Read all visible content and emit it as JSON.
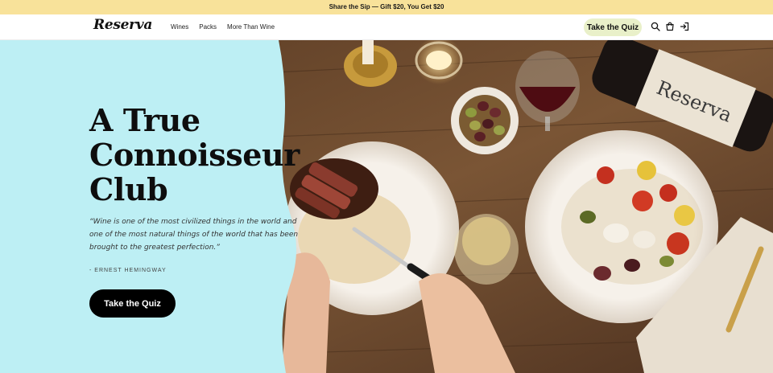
{
  "announcement": {
    "text": "Share the Sip — Gift $20, You Get $20"
  },
  "nav": {
    "logo": "Reserva",
    "links": [
      "Wines",
      "Packs",
      "More Than Wine"
    ],
    "quiz_button": "Take the Quiz",
    "icons": [
      "search-icon",
      "cart-icon",
      "sign-in-icon"
    ]
  },
  "hero": {
    "headline": "A True Connoisseur Club",
    "quote": "“Wine is one of the most civilized things in the world and one of the most natural things of the world that has been brought to the greatest perfection.”",
    "attribution": "- ERNEST HEMINGWAY",
    "cta": "Take the Quiz",
    "bottle_label": "Reserva",
    "panel_color": "#bdeff4"
  },
  "colors": {
    "announcement_bg": "#f8e29a",
    "quiz_pill_bg": "#e9f0c9",
    "cta_bg": "#000000",
    "table_wood": "#6b4a30"
  }
}
